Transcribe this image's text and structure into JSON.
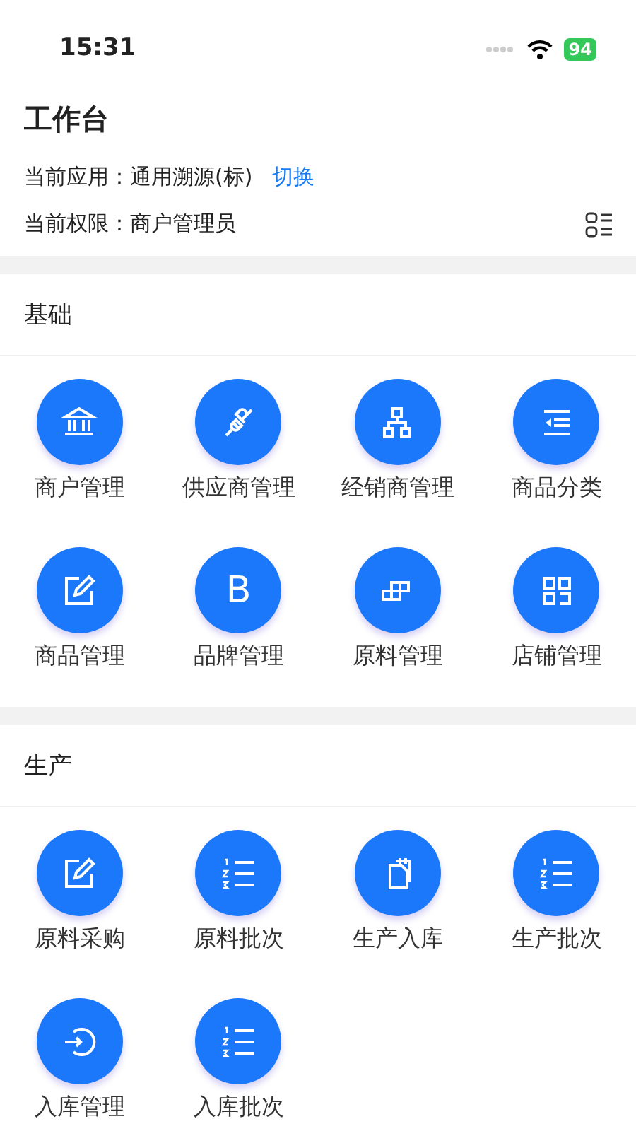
{
  "status_bar": {
    "time": "15:31",
    "battery": "94"
  },
  "header": {
    "title": "工作台",
    "app_label": "当前应用：",
    "app_value": "通用溯源(标)",
    "switch_link": "切换",
    "role_label": "当前权限：",
    "role_value": "商户管理员"
  },
  "sections": [
    {
      "title": "基础",
      "items": [
        {
          "label": "商户管理",
          "kind": "bank"
        },
        {
          "label": "供应商管理",
          "kind": "plug"
        },
        {
          "label": "经销商管理",
          "kind": "org"
        },
        {
          "label": "商品分类",
          "kind": "indent"
        },
        {
          "label": "商品管理",
          "kind": "edit"
        },
        {
          "label": "品牌管理",
          "kind": "letter",
          "glyph": "B"
        },
        {
          "label": "原料管理",
          "kind": "blocks"
        },
        {
          "label": "店铺管理",
          "kind": "grid"
        }
      ]
    },
    {
      "title": "生产",
      "items": [
        {
          "label": "原料采购",
          "kind": "edit"
        },
        {
          "label": "原料批次",
          "kind": "numlist"
        },
        {
          "label": "生产入库",
          "kind": "clipboard"
        },
        {
          "label": "生产批次",
          "kind": "numlist"
        },
        {
          "label": "入库管理",
          "kind": "login"
        },
        {
          "label": "入库批次",
          "kind": "numlist"
        }
      ]
    }
  ]
}
